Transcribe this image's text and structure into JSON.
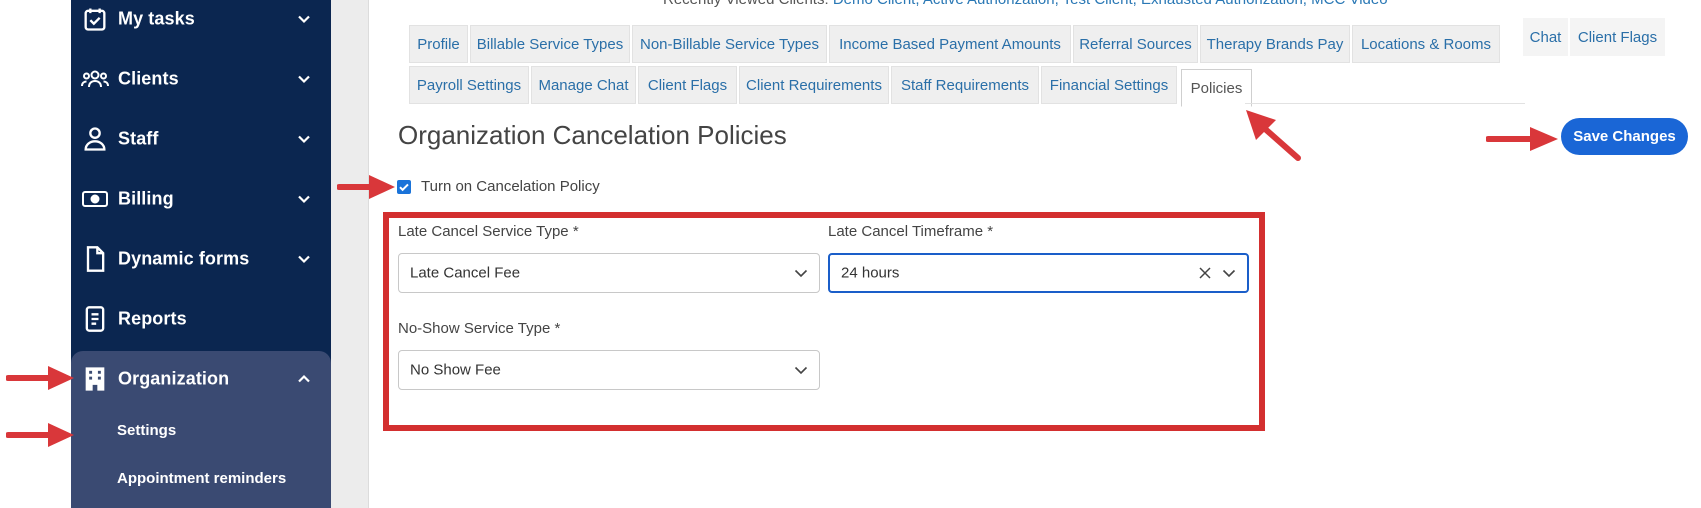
{
  "sidebar": {
    "items": [
      {
        "label": "My tasks",
        "icon": "calendar-check-icon"
      },
      {
        "label": "Clients",
        "icon": "users-icon"
      },
      {
        "label": "Staff",
        "icon": "person-badge-icon"
      },
      {
        "label": "Billing",
        "icon": "banknote-icon"
      },
      {
        "label": "Dynamic forms",
        "icon": "document-icon"
      },
      {
        "label": "Reports",
        "icon": "report-icon"
      },
      {
        "label": "Organization",
        "icon": "building-icon"
      }
    ],
    "subitems": [
      {
        "label": "Settings"
      },
      {
        "label": "Appointment reminders"
      }
    ]
  },
  "recent": {
    "prefix": "Recently Viewed Clients:",
    "links": "Demo Client, Active Authorization, Test Client, Exhausted Authorization, MCC Video"
  },
  "tabs": {
    "row1": [
      "Profile",
      "Billable Service Types",
      "Non-Billable Service Types",
      "Income Based Payment Amounts",
      "Referral Sources",
      "Therapy Brands Pay",
      "Locations & Rooms"
    ],
    "row2": [
      "Payroll Settings",
      "Manage Chat",
      "Client Flags",
      "Client Requirements",
      "Staff Requirements",
      "Financial Settings",
      "Policies"
    ],
    "overflow": [
      "Chat",
      "Client Flags"
    ]
  },
  "page": {
    "title": "Organization Cancelation Policies",
    "checkbox_label": "Turn on Cancelation Policy",
    "checkbox_checked": true,
    "save_label": "Save Changes"
  },
  "form": {
    "late_cancel_type_label": "Late Cancel Service Type *",
    "late_cancel_type_value": "Late Cancel Fee",
    "late_cancel_timeframe_label": "Late Cancel Timeframe *",
    "late_cancel_timeframe_value": "24 hours",
    "no_show_type_label": "No-Show Service Type *",
    "no_show_type_value": "No Show Fee"
  },
  "colors": {
    "sidebar_bg": "#0b2650",
    "sidebar_active_bg": "#3a4a72",
    "accent": "#1a66d6",
    "annotation_red": "#d32f2f",
    "tab_link": "#2a6fa8"
  }
}
